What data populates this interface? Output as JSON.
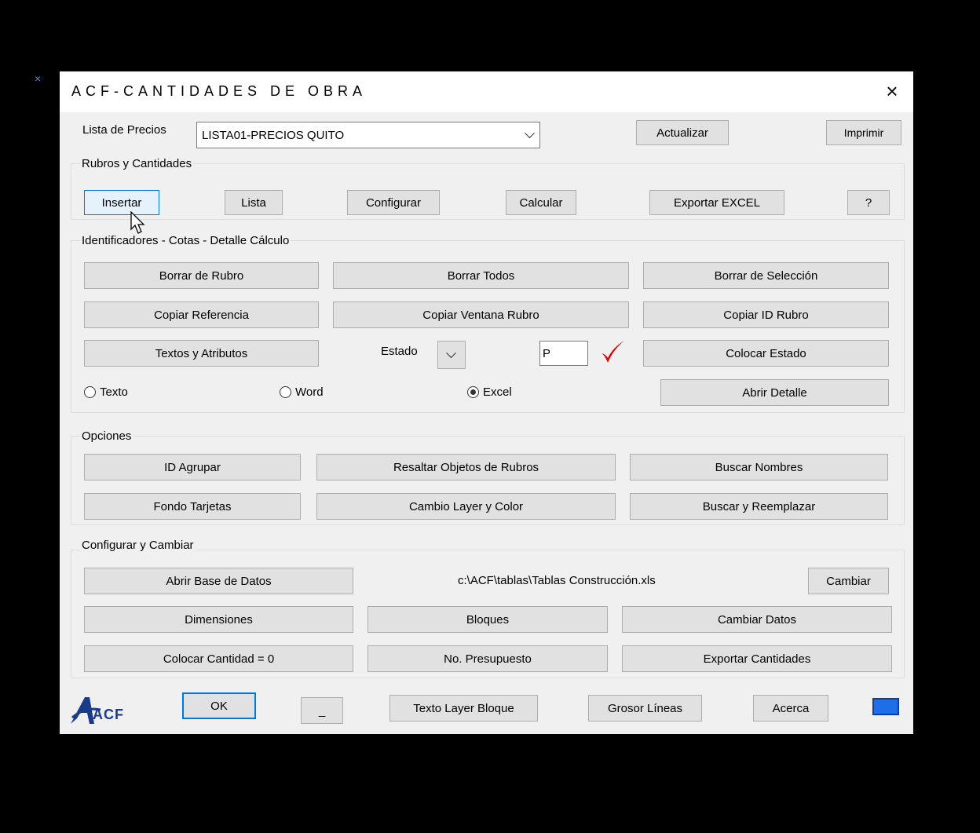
{
  "window": {
    "title": "ACF-CANTIDADES DE OBRA",
    "close_icon": "×"
  },
  "top": {
    "lista_label": "Lista de Precios",
    "lista_value": "LISTA01-PRECIOS QUITO",
    "actualizar": "Actualizar",
    "imprimir": "Imprimir"
  },
  "rubros": {
    "label": "Rubros y Cantidades",
    "insertar": "Insertar",
    "lista": "Lista",
    "configurar": "Configurar",
    "calcular": "Calcular",
    "exportar": "Exportar EXCEL",
    "help": "?"
  },
  "ident": {
    "label": "Identificadores - Cotas - Detalle Cálculo",
    "borrar_rubro": "Borrar de Rubro",
    "borrar_todos": "Borrar Todos",
    "borrar_seleccion": "Borrar de Selección",
    "copiar_referencia": "Copiar Referencia",
    "copiar_ventana": "Copiar Ventana Rubro",
    "copiar_id": "Copiar ID Rubro",
    "textos_atributos": "Textos y Atributos",
    "estado_label": "Estado",
    "estado_value": "P",
    "colocar_estado": "Colocar Estado",
    "radio_texto": "Texto",
    "radio_word": "Word",
    "radio_excel": "Excel",
    "selected_radio": "Excel",
    "abrir_detalle": "Abrir Detalle"
  },
  "opciones": {
    "label": "Opciones",
    "id_agrupar": "ID Agrupar",
    "resaltar": "Resaltar Objetos de Rubros",
    "buscar_nombres": "Buscar Nombres",
    "fondo_tarjetas": "Fondo Tarjetas",
    "cambio_layer": "Cambio Layer y Color",
    "buscar_reemplazar": "Buscar y Reemplazar"
  },
  "config": {
    "label": "Configurar y Cambiar",
    "abrir_bd": "Abrir Base de Datos",
    "path": "c:\\ACF\\tablas\\Tablas Construcción.xls",
    "cambiar": "Cambiar",
    "dimensiones": "Dimensiones",
    "bloques": "Bloques",
    "cambiar_datos": "Cambiar Datos",
    "colocar_cantidad": "Colocar Cantidad = 0",
    "no_presupuesto": "No. Presupuesto",
    "exportar_cantidades": "Exportar Cantidades"
  },
  "bottom": {
    "logo_text": "ACF",
    "ok": "OK",
    "minimize": "_",
    "texto_layer": "Texto Layer Bloque",
    "grosor": "Grosor Líneas",
    "acerca": "Acerca"
  },
  "colors": {
    "accent": "#0078d7",
    "check": "#e00000",
    "color_swatch": "#1e6ee6"
  }
}
